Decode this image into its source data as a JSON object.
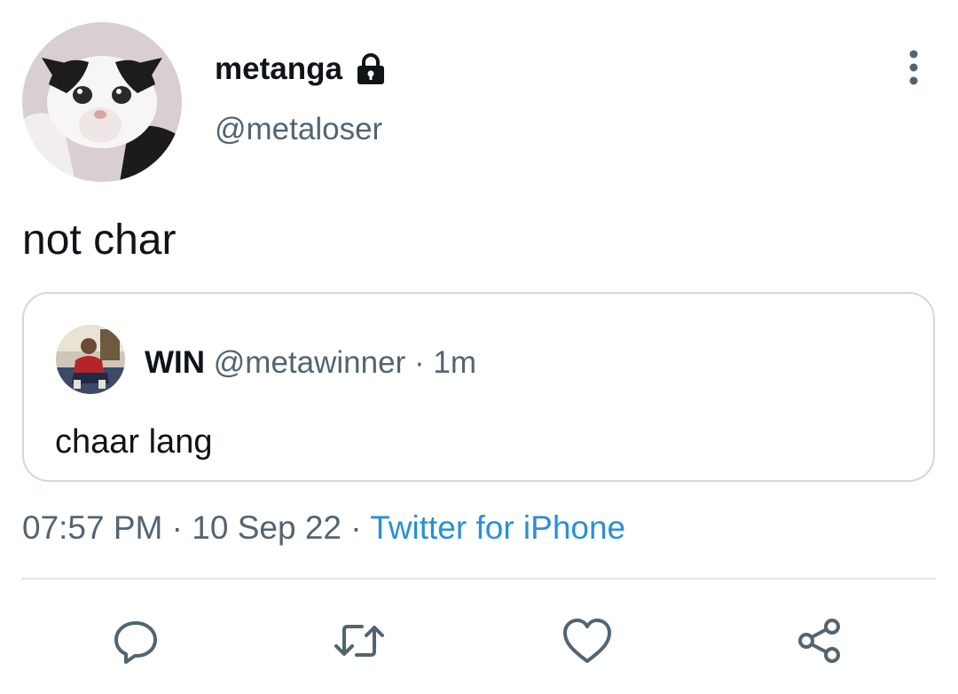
{
  "author": {
    "display_name": "metanga",
    "handle": "@metaloser",
    "avatar_icon": "cat-photo-avatar",
    "protected_icon": "lock-icon"
  },
  "tweet": {
    "text": "not char"
  },
  "quoted_tweet": {
    "display_name": "WIN",
    "handle": "@metawinner",
    "separator": "·",
    "time_ago": "1m",
    "text": "chaar lang"
  },
  "meta": {
    "time": "07:57 PM",
    "separator": "·",
    "date": "10 Sep 22",
    "source": "Twitter for iPhone"
  },
  "actions": [
    {
      "icon": "reply-icon"
    },
    {
      "icon": "retweet-icon"
    },
    {
      "icon": "like-icon"
    },
    {
      "icon": "share-icon"
    }
  ],
  "colors": {
    "text_primary": "#0f1419",
    "text_secondary": "#536471",
    "link": "#2b8fd6",
    "border": "#cfd9de",
    "icon": "#536471"
  }
}
